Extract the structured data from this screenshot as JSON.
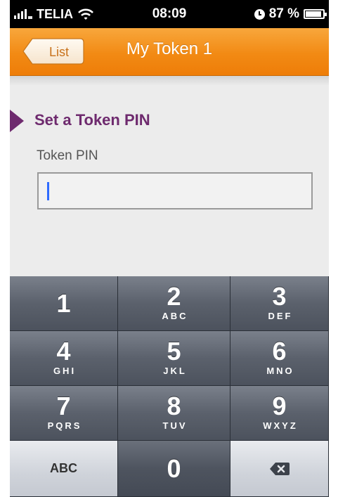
{
  "status_bar": {
    "carrier": "TELIA",
    "time": "08:09",
    "battery_text": "87 %",
    "signal_icon": "signal-bars-icon",
    "wifi_icon": "wifi-icon",
    "clock_icon": "alarm-clock-icon",
    "battery_icon": "battery-icon"
  },
  "nav": {
    "title": "My Token 1",
    "back_label": "List"
  },
  "content": {
    "section_title": "Set a Token PIN",
    "field_label": "Token PIN",
    "pin_value": ""
  },
  "keypad": {
    "keys": [
      {
        "digit": "1",
        "letters": ""
      },
      {
        "digit": "2",
        "letters": "ABC"
      },
      {
        "digit": "3",
        "letters": "DEF"
      },
      {
        "digit": "4",
        "letters": "GHI"
      },
      {
        "digit": "5",
        "letters": "JKL"
      },
      {
        "digit": "6",
        "letters": "MNO"
      },
      {
        "digit": "7",
        "letters": "PQRS"
      },
      {
        "digit": "8",
        "letters": "TUV"
      },
      {
        "digit": "9",
        "letters": "WXYZ"
      }
    ],
    "abc_label": "ABC",
    "zero": "0",
    "delete_icon": "backspace-icon"
  },
  "colors": {
    "nav_orange": "#f28a14",
    "section_purple": "#6e2a6e",
    "caret_blue": "#2f6bff",
    "keypad_dark": "#5b616c"
  }
}
